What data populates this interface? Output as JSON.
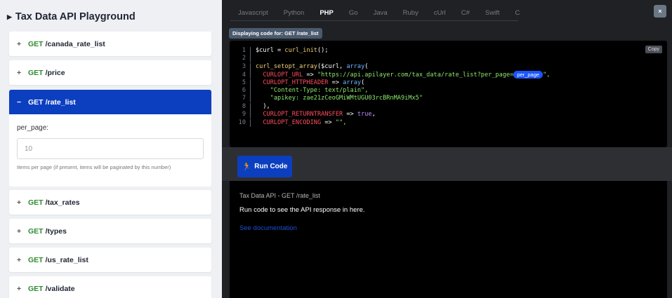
{
  "sidebar": {
    "title": "Tax Data API Playground",
    "endpoints": [
      {
        "symbol": "+",
        "method": "GET",
        "path": "/canada_rate_list"
      },
      {
        "symbol": "+",
        "method": "GET",
        "path": "/price"
      },
      {
        "symbol": "−",
        "method": "GET",
        "path": "/rate_list"
      },
      {
        "symbol": "+",
        "method": "GET",
        "path": "/tax_rates"
      },
      {
        "symbol": "+",
        "method": "GET",
        "path": "/types"
      },
      {
        "symbol": "+",
        "method": "GET",
        "path": "/us_rate_list"
      },
      {
        "symbol": "+",
        "method": "GET",
        "path": "/validate"
      }
    ],
    "param": {
      "label": "per_page:",
      "placeholder": "10",
      "help": "Items per page (if present, items will be paginated by this number)"
    }
  },
  "tabs": [
    "Javascript",
    "Python",
    "PHP",
    "Go",
    "Java",
    "Ruby",
    "cUrl",
    "C#",
    "Swift",
    "C"
  ],
  "active_tab": "PHP",
  "close_label": "×",
  "code_badge": "Displaying code for: GET /rate_list",
  "copy_label": "Copy",
  "code_lines": [
    {
      "n": "1",
      "parts": [
        [
          "$curl = ",
          "w"
        ],
        [
          "curl_init",
          "y"
        ],
        [
          "();",
          "w"
        ]
      ]
    },
    {
      "n": "2",
      "parts": []
    },
    {
      "n": "3",
      "parts": [
        [
          "curl_setopt_array",
          "y"
        ],
        [
          "($curl, ",
          "w"
        ],
        [
          "array",
          "b"
        ],
        [
          "(",
          "w"
        ]
      ]
    },
    {
      "n": "4",
      "parts": [
        [
          "  CURLOPT_URL",
          "r"
        ],
        [
          " => ",
          "w"
        ],
        [
          "\"https://api.apilayer.com/tax_data/rate_list?per_page=",
          "g"
        ],
        [
          "per_page",
          "pill"
        ],
        [
          "\",",
          "g"
        ]
      ]
    },
    {
      "n": "5",
      "parts": [
        [
          "  CURLOPT_HTTPHEADER",
          "r"
        ],
        [
          " => ",
          "w"
        ],
        [
          "array",
          "b"
        ],
        [
          "(",
          "w"
        ]
      ]
    },
    {
      "n": "6",
      "parts": [
        [
          "    \"Content-Type: text/plain\",",
          "g"
        ]
      ]
    },
    {
      "n": "7",
      "parts": [
        [
          "    \"apikey: zae21zCeoGMiWMtUGU03rcBRnMA9iMx5\"",
          "g"
        ]
      ]
    },
    {
      "n": "8",
      "parts": [
        [
          "  ),",
          "w"
        ]
      ]
    },
    {
      "n": "9",
      "parts": [
        [
          "  CURLOPT_RETURNTRANSFER",
          "r"
        ],
        [
          " => ",
          "w"
        ],
        [
          "true",
          "p"
        ],
        [
          ",",
          "w"
        ]
      ]
    },
    {
      "n": "10",
      "parts": [
        [
          "  CURLOPT_ENCODING",
          "r"
        ],
        [
          " => ",
          "w"
        ],
        [
          "\"\",",
          "g"
        ]
      ]
    }
  ],
  "run_label": "Run Code",
  "response": {
    "title": "Tax Data API - GET /rate_list",
    "message": "Run code to see the API response in here.",
    "doc_link": "See documentation"
  }
}
